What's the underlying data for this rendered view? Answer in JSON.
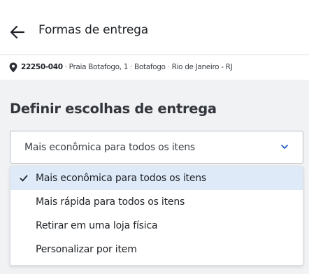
{
  "header": {
    "title": "Formas de entrega",
    "back_icon": "arrow-left-icon"
  },
  "address": {
    "icon": "map-pin-icon",
    "cep": "22250-040",
    "street": "Praia Botafogo, 1",
    "neighborhood": "Botafogo",
    "city": "Rio de Janeiro - RJ",
    "separator": "·"
  },
  "section": {
    "title": "Definir escolhas de entrega"
  },
  "select": {
    "value": "Mais econômica para todos os itens",
    "chevron_icon": "chevron-down-icon",
    "accent_color": "#1e5bc6"
  },
  "dropdown": {
    "check_icon": "checkmark-icon",
    "selected_bg": "#dfeaf9",
    "options": [
      {
        "label": "Mais econômica para todos os itens",
        "selected": true
      },
      {
        "label": "Mais rápida para todos os itens",
        "selected": false
      },
      {
        "label": "Retirar em uma loja física",
        "selected": false
      },
      {
        "label": "Personalizar por item",
        "selected": false
      }
    ]
  }
}
